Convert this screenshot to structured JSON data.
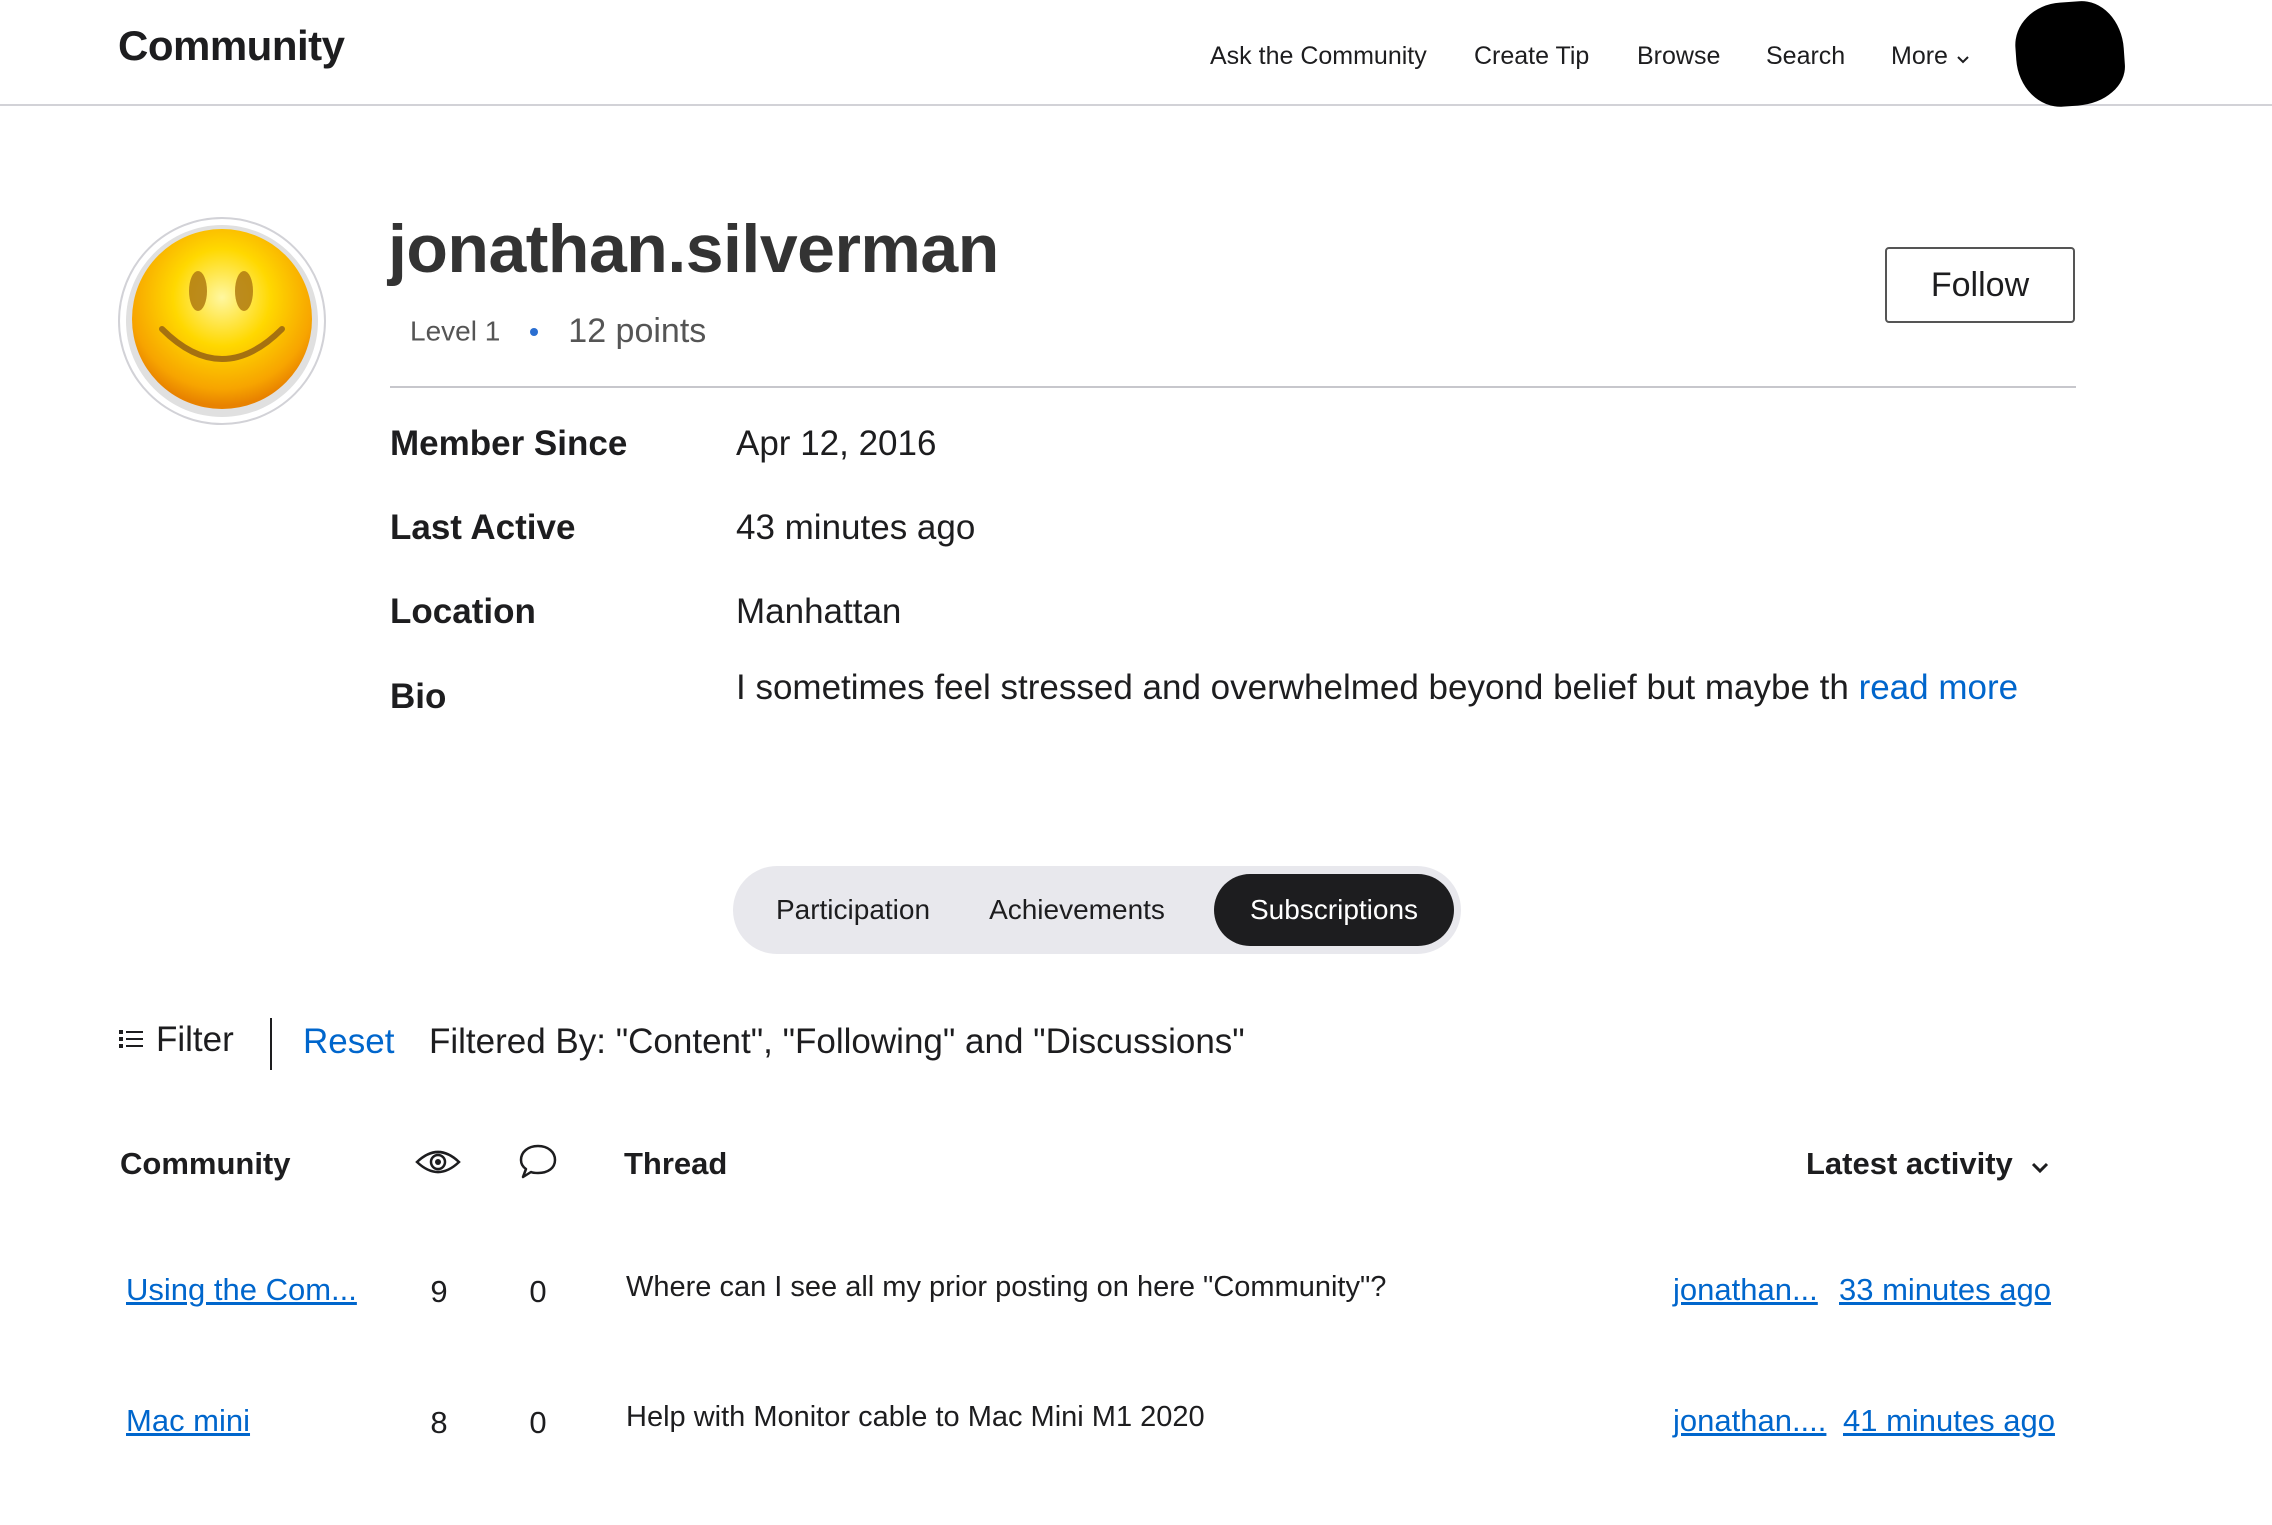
{
  "header": {
    "brand": "Community",
    "nav": {
      "ask": "Ask the Community",
      "create_tip": "Create Tip",
      "browse": "Browse",
      "search": "Search",
      "more": "More"
    }
  },
  "profile": {
    "username": "jonathan.silverman",
    "level": "Level 1",
    "points": "12 points",
    "follow_label": "Follow",
    "details": {
      "member_since_label": "Member Since",
      "member_since_value": "Apr 12, 2016",
      "last_active_label": "Last Active",
      "last_active_value": "43 minutes ago",
      "location_label": "Location",
      "location_value": "Manhattan",
      "bio_label": "Bio",
      "bio_value": "I sometimes feel stressed and overwhelmed beyond belief but maybe th",
      "read_more": "read more"
    }
  },
  "tabs": {
    "participation": "Participation",
    "achievements": "Achievements",
    "subscriptions": "Subscriptions",
    "active": "Subscriptions"
  },
  "filter": {
    "label": "Filter",
    "reset": "Reset",
    "filtered_by": "Filtered By: \"Content\", \"Following\" and \"Discussions\""
  },
  "table": {
    "headers": {
      "community": "Community",
      "thread": "Thread",
      "latest": "Latest activity"
    },
    "rows": [
      {
        "community": "Using the Com...",
        "views": "9",
        "replies": "0",
        "thread": "Where can I see all my prior posting on here \"Community\"?",
        "author": "jonathan...",
        "time": "33 minutes ago"
      },
      {
        "community": "Mac mini",
        "views": "8",
        "replies": "0",
        "thread": "Help with Monitor cable to Mac Mini M1 2020",
        "author": "jonathan....",
        "time": "41 minutes ago"
      }
    ]
  },
  "colors": {
    "link": "#0066cc",
    "active_tab": "#1d1d1f",
    "tab_track": "#e8e8ed",
    "level_dot": "#2a6ed1"
  }
}
